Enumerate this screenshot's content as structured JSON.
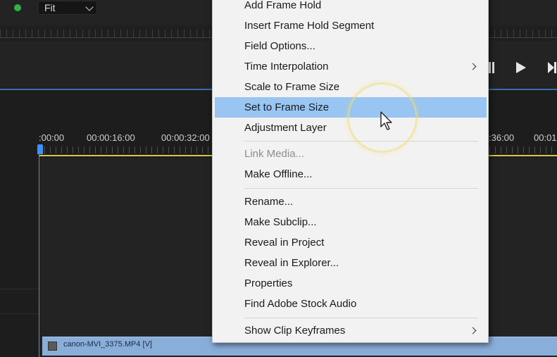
{
  "monitor": {
    "zoom_select": "Fit"
  },
  "timeline": {
    "timecodes": [
      ":00:00",
      "00:00:16:00",
      "00:00:32:00",
      ":36:00",
      "00:01"
    ],
    "clip_label": "canon-MVI_3375.MP4 [V]"
  },
  "context_menu": {
    "items": [
      {
        "label": "Add Frame Hold",
        "state": "normal"
      },
      {
        "label": "Insert Frame Hold Segment",
        "state": "normal"
      },
      {
        "label": "Field Options...",
        "state": "normal"
      },
      {
        "label": "Time Interpolation",
        "state": "normal",
        "submenu": true
      },
      {
        "label": "Scale to Frame Size",
        "state": "normal"
      },
      {
        "label": "Set to Frame Size",
        "state": "highlighted"
      },
      {
        "label": "Adjustment Layer",
        "state": "normal"
      },
      {
        "label": "Link Media...",
        "state": "disabled"
      },
      {
        "label": "Make Offline...",
        "state": "normal"
      },
      {
        "label": "Rename...",
        "state": "normal"
      },
      {
        "label": "Make Subclip...",
        "state": "normal"
      },
      {
        "label": "Reveal in Project",
        "state": "normal"
      },
      {
        "label": "Reveal in Explorer...",
        "state": "normal"
      },
      {
        "label": "Properties",
        "state": "normal"
      },
      {
        "label": "Find Adobe Stock Audio",
        "state": "normal"
      },
      {
        "label": "Show Clip Keyframes",
        "state": "normal",
        "submenu": true
      }
    ]
  },
  "colors": {
    "accent_blue": "#3d8eff",
    "menu_highlight": "#99c5f2",
    "work_area_yellow": "#d9c64a",
    "clip_blue": "#8aaeda"
  },
  "icons": [
    "status-dot-icon",
    "chevron-down-icon",
    "step-back-icon",
    "play-icon",
    "step-forward-icon",
    "fx-icon",
    "chevron-right-icon",
    "pointer-cursor-icon"
  ]
}
